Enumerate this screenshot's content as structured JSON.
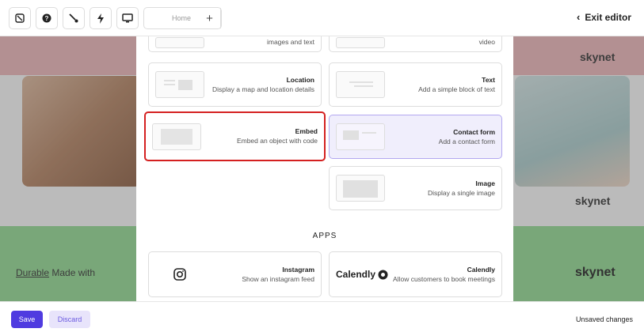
{
  "topbar": {
    "exit_label": "Exit editor",
    "page_select": "Home",
    "add_symbol": "+",
    "icons": [
      "back-icon",
      "help-icon",
      "brush-icon",
      "bolt-icon",
      "monitor-icon"
    ]
  },
  "background": {
    "brand_left": "skynet",
    "brand_right": "skynet",
    "made_with_prefix": "Made with",
    "made_with_brand": "Durable",
    "brand_footer": "skynet"
  },
  "panel": {
    "cards": [
      {
        "id": "images-text",
        "title": "",
        "desc": "images and text"
      },
      {
        "id": "video",
        "title": "",
        "desc": "video"
      },
      {
        "id": "location",
        "title": "Location",
        "desc": "Display a map and location details"
      },
      {
        "id": "text",
        "title": "Text",
        "desc": "Add a simple block of text"
      },
      {
        "id": "embed",
        "title": "Embed",
        "desc": "Embed an object with code"
      },
      {
        "id": "contact",
        "title": "Contact form",
        "desc": "Add a contact form"
      },
      {
        "id": "image",
        "title": "Image",
        "desc": "Display a single image"
      }
    ],
    "apps_heading": "APPS",
    "apps": [
      {
        "id": "instagram",
        "title": "Instagram",
        "desc": "Show an instagram feed"
      },
      {
        "id": "calendly",
        "title": "Calendly",
        "desc": "Allow customers to book meetings",
        "logo": "Calendly"
      }
    ]
  },
  "footer": {
    "save_label": "Save",
    "discard_label": "Discard",
    "status": "Unsaved changes"
  },
  "colors": {
    "accent": "#4f3be0",
    "highlight": "#d42020",
    "pink": "#e9b3b6",
    "green": "#8fd68f"
  }
}
